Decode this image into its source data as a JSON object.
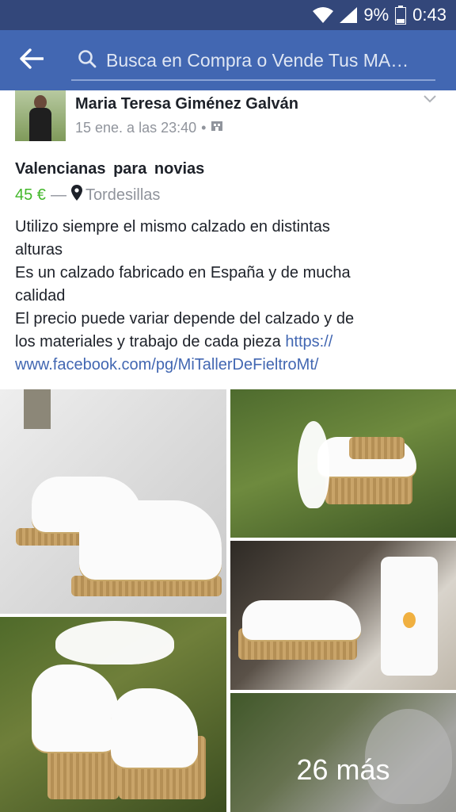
{
  "status_bar": {
    "battery": "9%",
    "time": "0:43"
  },
  "search": {
    "placeholder": "Busca en Compra o Vende Tus MA…"
  },
  "post": {
    "author": "Maria Teresa Giménez Galván",
    "timestamp": "15 ene. a las 23:40",
    "title": "Valencianas  para  novias",
    "price": "45 €",
    "separator": "—",
    "location": "Tordesillas",
    "description_lines": [
      "Utilizo  siempre  el mismo   calzado   en distintas",
      "alturas",
      "  Es un calzado  fabricado  en  España  y  de mucha",
      "calidad",
      "    El precio  puede  variar  depende  del calzado  y   de",
      "los materiales  y  trabajo  de cada  pieza "
    ],
    "link_part1": "https://",
    "link_part2": "www.facebook.com/pg/MiTallerDeFieltroMt/"
  },
  "gallery": {
    "more_label": "26 más"
  },
  "colors": {
    "header": "#4267b2",
    "status_bar": "#33477a",
    "price": "#42b72a",
    "link": "#4267b2"
  },
  "icons": [
    "wifi-icon",
    "signal-icon",
    "battery-icon",
    "back-arrow-icon",
    "search-icon",
    "chevron-down-icon",
    "location-pin-icon",
    "privacy-icon"
  ]
}
